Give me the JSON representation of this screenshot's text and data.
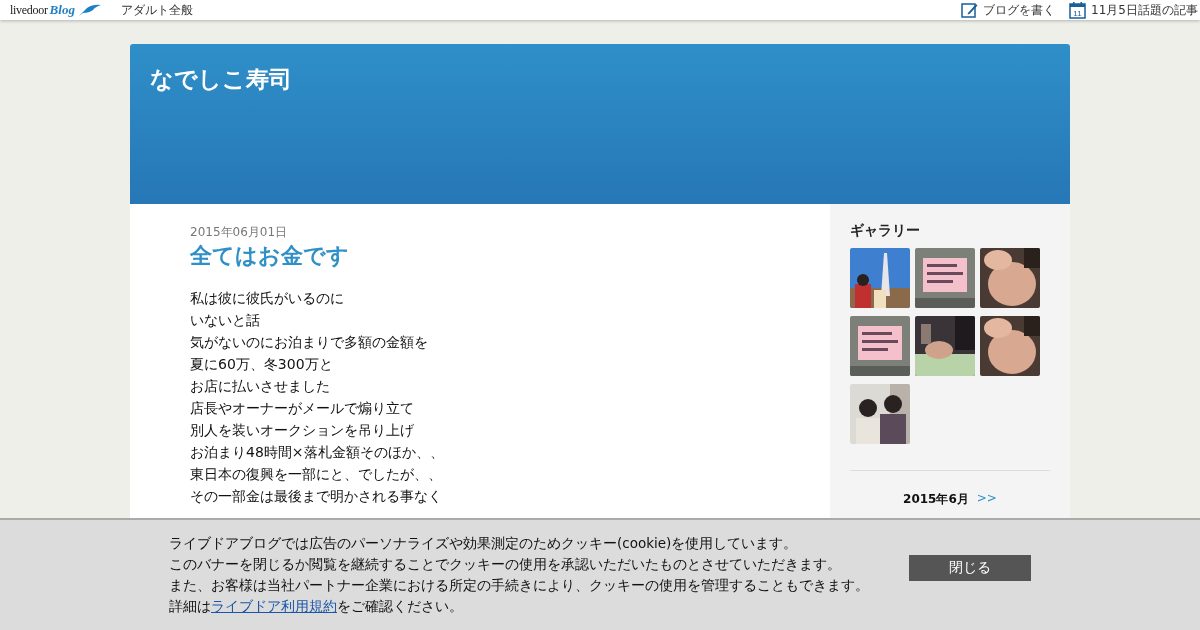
{
  "topbar": {
    "logo": {
      "word": "livedoor",
      "sub": "Blog"
    },
    "category": "アダルト全般",
    "actions": [
      {
        "kind": "write",
        "label": "ブログを書く"
      },
      {
        "kind": "calendar",
        "label": "11月5日話題の記事",
        "day": "11"
      }
    ]
  },
  "blog": {
    "title": "なでしこ寿司"
  },
  "article": {
    "date": "2015年06月01日",
    "title": "全てはお金です",
    "lines": [
      "私は彼に彼氏がいるのに",
      "いないと話",
      "気がないのにお泊まりで多額の金額を",
      "夏に60万、冬300万と",
      "お店に払いさせました",
      "店長やオーナーがメールで煽り立て",
      "別人を装いオークションを吊り上げ",
      "お泊まり48時間×落札金額そのほか、、",
      "東日本の復興を一部にと、でしたが、、",
      "その一部金は最後まで明かされる事なく"
    ]
  },
  "sidebar": {
    "gallery_title": "ギャラリー",
    "calendar": {
      "month": "2015年6月",
      "next": ">>"
    }
  },
  "cookie_banner": {
    "lines": [
      "ライブドアブログでは広告のパーソナライズや効果測定のためクッキー(cookie)を使用しています。",
      "このバナーを閉じるか閲覧を継続することでクッキーの使用を承認いただいたものとさせていただきます。",
      "また、お客様は当社パートナー企業における所定の手続きにより、クッキーの使用を管理することもできます。"
    ],
    "last_line": {
      "before": "詳細は",
      "link": "ライブドア利用規約",
      "after": "をご確認ください。"
    },
    "close": "閉じる"
  }
}
